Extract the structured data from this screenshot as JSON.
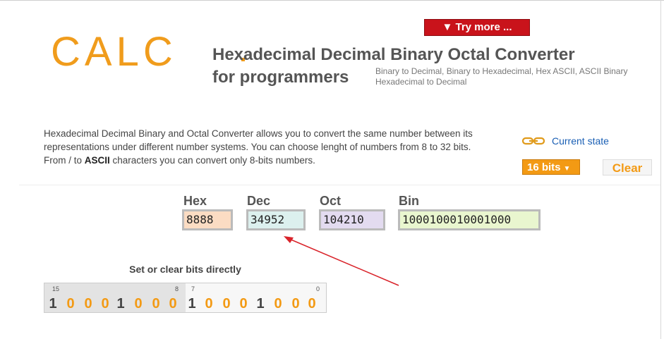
{
  "brand": {
    "logo_text": "CALC",
    "title_line1": "Hexadecimal Decimal Binary Octal Converter",
    "title_line2": "for programmers",
    "subtitle_line1": "Binary to Decimal, Binary to Hexadecimal, Hex ASCII, ASCII Binary",
    "subtitle_line2": "Hexadecimal to Decimal"
  },
  "try_more": {
    "label": "▼ Try more ..."
  },
  "description": {
    "part1": "Hexadecimal Decimal Binary and Octal Converter allows you to convert the same number between its representations under different number systems. You can choose lenght of numbers from 8 to 32 bits. From / to ",
    "bold": "ASCII",
    "part2": " characters you can convert only 8-bits numbers."
  },
  "controls": {
    "current_state": "Current state",
    "bits": "16 bits",
    "bits_chevron": "▼",
    "clear": "Clear"
  },
  "fields": {
    "hex": {
      "label": "Hex",
      "value": "8888"
    },
    "dec": {
      "label": "Dec",
      "value": "34952"
    },
    "oct": {
      "label": "Oct",
      "value": "104210"
    },
    "bin": {
      "label": "Bin",
      "value": "1000100010001000"
    }
  },
  "bit_editor": {
    "title": "Set or clear bits directly",
    "index_labels": [
      "15",
      "8",
      "7",
      "0"
    ],
    "bits": [
      "1",
      "0",
      "0",
      "0",
      "1",
      "0",
      "0",
      "0",
      "1",
      "0",
      "0",
      "0",
      "1",
      "0",
      "0",
      "0"
    ]
  },
  "colors": {
    "accent": "#f39a14",
    "try_more_bg": "#c9131b",
    "arrow": "#d9232a",
    "link": "#1a5fb4"
  }
}
